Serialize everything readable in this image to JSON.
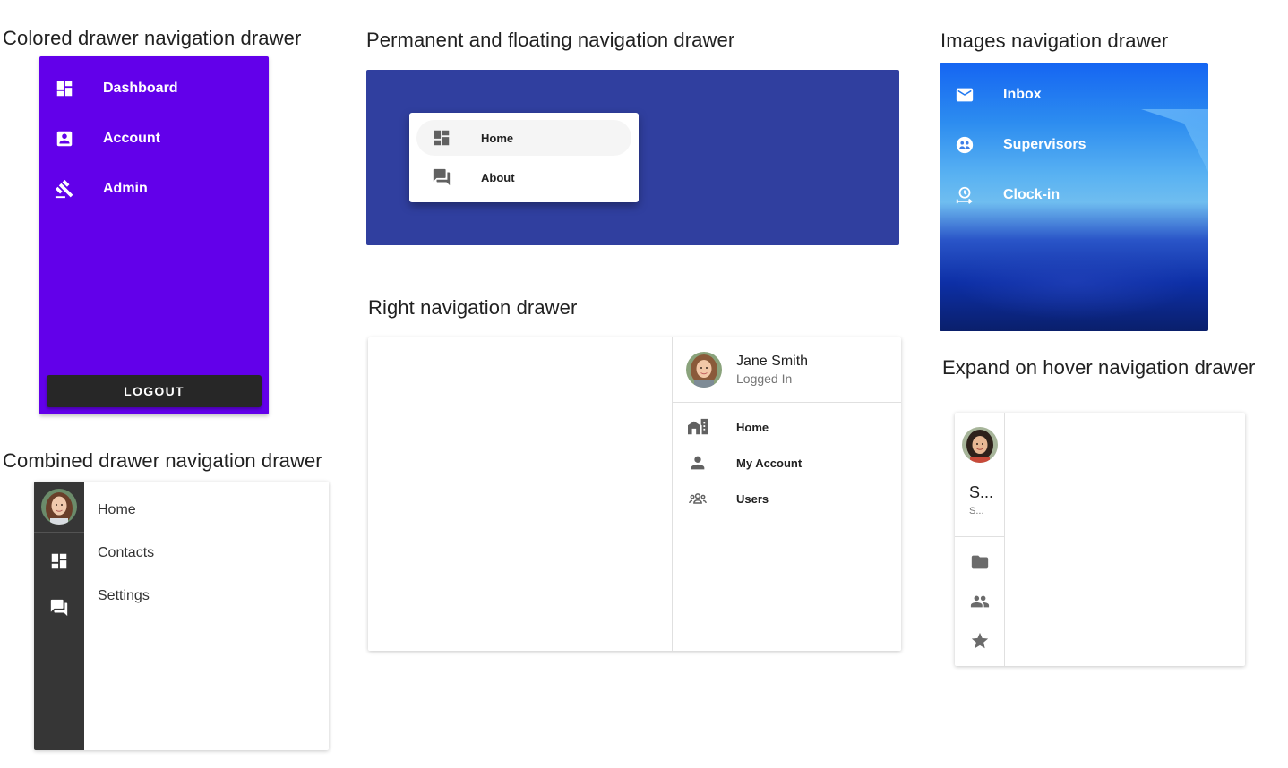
{
  "titles": {
    "colored": "Colored drawer navigation drawer",
    "permanent": "Permanent and floating navigation drawer",
    "images": "Images navigation drawer",
    "right": "Right navigation drawer",
    "expand": "Expand on hover navigation drawer",
    "combined": "Combined drawer navigation drawer"
  },
  "colored_drawer": {
    "background": "#6200ea",
    "items": [
      {
        "icon": "dashboard-icon",
        "label": "Dashboard"
      },
      {
        "icon": "account-box-icon",
        "label": "Account"
      },
      {
        "icon": "gavel-icon",
        "label": "Admin"
      }
    ],
    "logout_label": "LOGOUT"
  },
  "permanent_drawer": {
    "background": "#303f9f",
    "items": [
      {
        "icon": "dashboard-icon",
        "label": "Home",
        "active": true
      },
      {
        "icon": "forum-icon",
        "label": "About"
      }
    ]
  },
  "images_drawer": {
    "items": [
      {
        "icon": "email-icon",
        "label": "Inbox"
      },
      {
        "icon": "supervisor-icon",
        "label": "Supervisors"
      },
      {
        "icon": "clock-in-icon",
        "label": "Clock-in"
      }
    ]
  },
  "right_drawer": {
    "user": {
      "name": "Jane Smith",
      "status": "Logged In"
    },
    "items": [
      {
        "icon": "home-city-icon",
        "label": "Home"
      },
      {
        "icon": "account-icon",
        "label": "My Account"
      },
      {
        "icon": "users-icon",
        "label": "Users"
      }
    ]
  },
  "expand_drawer": {
    "user": {
      "name": "S...",
      "subtitle": "S..."
    },
    "items": [
      {
        "icon": "folder-icon"
      },
      {
        "icon": "group-icon"
      },
      {
        "icon": "star-icon"
      }
    ]
  },
  "combined_drawer": {
    "background": "#363636",
    "rail_items": [
      {
        "icon": "dashboard-icon"
      },
      {
        "icon": "forum-icon"
      }
    ],
    "links": [
      "Home",
      "Contacts",
      "Settings"
    ]
  }
}
